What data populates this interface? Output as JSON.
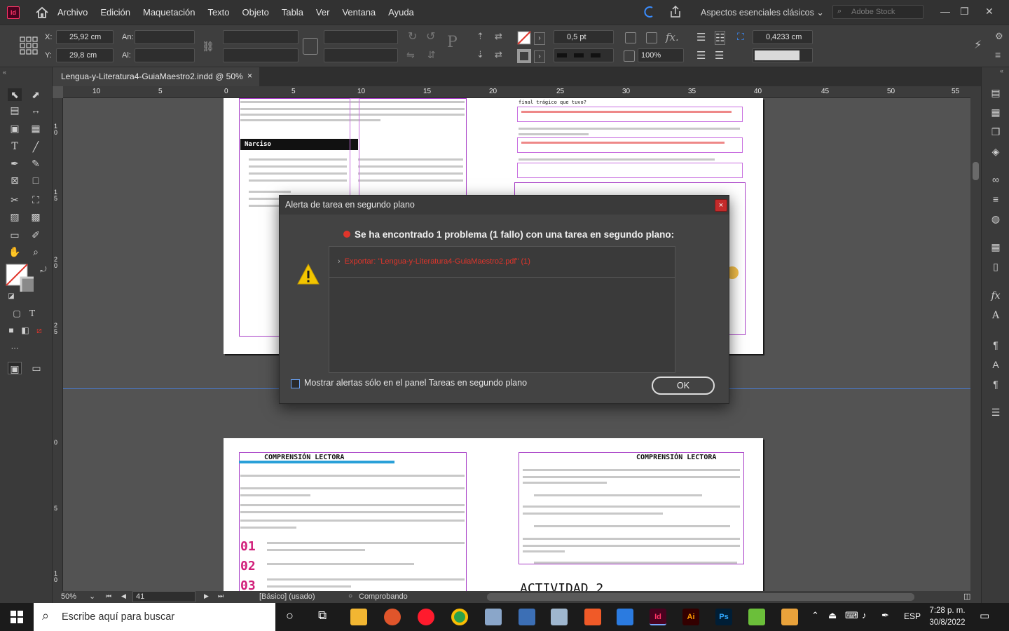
{
  "app": {
    "logo": "Id",
    "menu": [
      "Archivo",
      "Edición",
      "Maquetación",
      "Texto",
      "Objeto",
      "Tabla",
      "Ver",
      "Ventana",
      "Ayuda"
    ],
    "workspace": "Aspectos esenciales clásicos",
    "stock_placeholder": "Adobe Stock"
  },
  "control": {
    "x_label": "X:",
    "x_value": "25,92 cm",
    "y_label": "Y:",
    "y_value": "29,8 cm",
    "w_label": "An:",
    "h_label": "Al:",
    "stroke_weight": "0,5 pt",
    "scale": "100%",
    "offset": "0,4233 cm"
  },
  "document": {
    "tab_title": "Lengua-y-Literatura4-GuiaMaestro2.indd @ 50%",
    "close_glyph": "×"
  },
  "rulers": {
    "h_ticks": [
      "10",
      "5",
      "0",
      "5",
      "10",
      "15",
      "20",
      "25",
      "30",
      "35",
      "40",
      "45",
      "50",
      "55"
    ],
    "v_ticks": [
      "1 0",
      "1 5",
      "2 0",
      "2 5",
      "0",
      "5",
      "1 0"
    ]
  },
  "pages": {
    "top_left_snippet": "Narciso",
    "top_right_title": "final trágico que tuvo?",
    "bottom_left_header": "COMPRENSIÓN LECTORA",
    "bottom_right_header": "COMPRENSIÓN LECTORA",
    "bottom_left_markers": [
      "01",
      "02",
      "03"
    ],
    "bottom_right_activity": "ACTIVIDAD 2"
  },
  "status": {
    "zoom": "50%",
    "page": "41",
    "style": "[Básico] (usado)",
    "preflight": "Comprobando"
  },
  "dialog": {
    "title": "Alerta de tarea en segundo plano",
    "heading": "Se ha encontrado 1 problema (1 fallo) con una tarea en segundo plano:",
    "error_item": "Exportar: \"Lengua-y-Literatura4-GuiaMaestro2.pdf\" (1)",
    "checkbox_label": "Mostrar alertas sólo en el panel Tareas en segundo plano",
    "ok_label": "OK",
    "close_glyph": "×"
  },
  "taskbar": {
    "search_placeholder": "Escribe aquí para buscar",
    "lang": "ESP",
    "time": "7:28 p. m.",
    "date": "30/8/2022",
    "apps": [
      {
        "name": "InDesign",
        "glyph": "Id",
        "color": "#ff3366",
        "bg": "#49021f"
      },
      {
        "name": "Illustrator",
        "glyph": "Ai",
        "color": "#ff9a00",
        "bg": "#330000"
      },
      {
        "name": "Photoshop",
        "glyph": "Ps",
        "color": "#31a8ff",
        "bg": "#001e36"
      }
    ]
  },
  "colors": {
    "accent_error": "#e0352b",
    "frame_guide": "#a83ec7",
    "dialog_bg": "#434343"
  }
}
